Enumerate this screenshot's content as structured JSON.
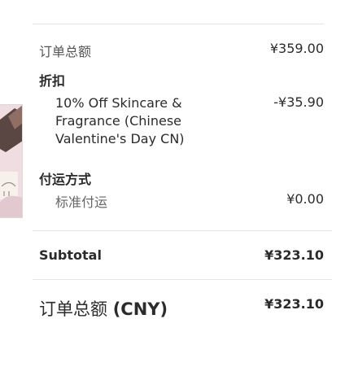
{
  "order": {
    "order_total_label": "订单总额",
    "order_total_value": "¥359.00",
    "discount_heading": "折扣",
    "discount_description": "10% Off Skincare & Fragrance (Chinese Valentine's Day CN)",
    "discount_value": "-¥35.90",
    "shipping_heading": "付运方式",
    "shipping_method": "标准付运",
    "shipping_value": "¥0.00"
  },
  "subtotal": {
    "label": "Subtotal",
    "value": "¥323.10"
  },
  "grand_total": {
    "label_prefix": "订单总额",
    "currency": "(CNY)",
    "value": "¥323.10"
  },
  "colors": {
    "divider": "#e3e3e3",
    "text_primary": "#2b2b2b",
    "text_secondary": "#555555"
  }
}
